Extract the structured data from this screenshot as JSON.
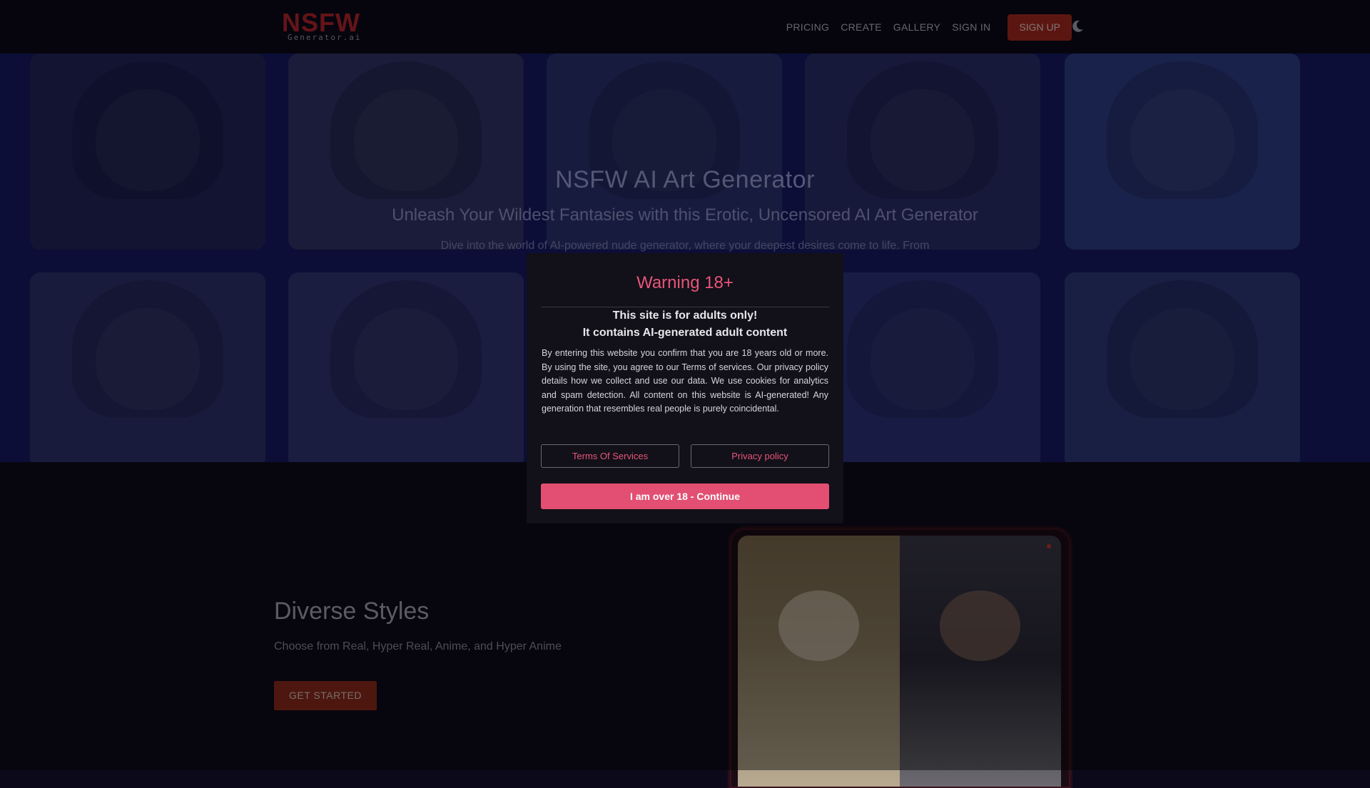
{
  "nav": {
    "logo_main": "NSFW",
    "logo_sub": "Generator.ai",
    "links": [
      "PRICING",
      "CREATE",
      "GALLERY",
      "SIGN IN"
    ],
    "signup": "SIGN UP",
    "theme_icon": "moon-icon"
  },
  "hero": {
    "title": "NSFW AI Art Generator",
    "subtitle": "Unleash Your Wildest Fantasies with this Erotic, Uncensored AI Art Generator",
    "description": "Dive into the world of AI-powered nude generator, where your deepest desires come to life. From hyper-realistic to ... rt tailored to your"
  },
  "styles": {
    "title": "Diverse Styles",
    "description": "Choose from Real, Hyper Real, Anime, and Hyper Anime",
    "cta": "GET STARTED"
  },
  "modal": {
    "title": "Warning 18+",
    "heading1": "This site is for adults only!",
    "heading2": "It contains AI-generated adult content",
    "body": "By entering this website you confirm that you are 18 years old or more. By using the site, you agree to our Terms of services. Our privacy policy details how we collect and use our data. We use cookies for analytics and spam detection. All content on this website is AI-generated! Any generation that resembles real people is purely coincidental.",
    "tos_button": "Terms Of Services",
    "privacy_button": "Privacy policy",
    "continue_button": "I am over 18 - Continue"
  },
  "colors": {
    "brand_red": "#b5252e",
    "modal_accent": "#e24f72",
    "hero_tint": "#1a1f7a"
  }
}
